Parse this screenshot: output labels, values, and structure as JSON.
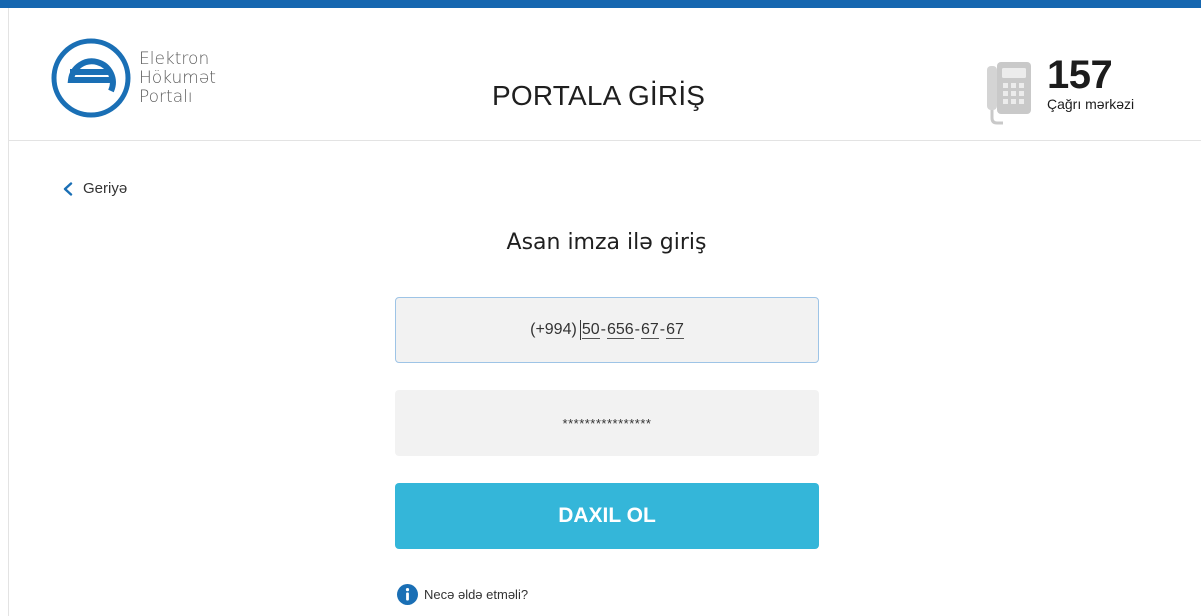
{
  "header": {
    "logo_lines": [
      "Elektron",
      "Hökumət",
      "Portalı"
    ],
    "title": "PORTALA GİRİŞ",
    "call_center": {
      "number": "157",
      "label": "Çağrı mərkəzi",
      "icon": "phone-icon"
    }
  },
  "nav": {
    "back_label": "Geriyə",
    "back_icon": "chevron-left-icon"
  },
  "form": {
    "title": "Asan imza ilə giriş",
    "phone": {
      "prefix": "(+994)",
      "parts": [
        "50",
        "656",
        "67",
        "67"
      ]
    },
    "pin_masked": "****************",
    "submit_label": "DAXIL OL",
    "help_label": "Necə əldə etməli?",
    "help_icon": "info-icon"
  },
  "colors": {
    "top_stripe": "#1667b0",
    "logo": "#1a6fb5",
    "submit": "#34b6d9",
    "info_icon": "#1a6fb5",
    "input_bg": "#f2f2f2",
    "input_focus_border": "#9ec4e6"
  }
}
